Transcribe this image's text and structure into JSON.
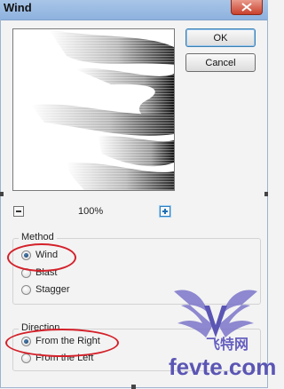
{
  "window": {
    "title": "Wind"
  },
  "buttons": {
    "ok_label": "OK",
    "cancel_label": "Cancel"
  },
  "preview": {
    "zoom_label": "100%"
  },
  "method": {
    "title": "Method",
    "options": [
      {
        "label": "Wind",
        "checked": true
      },
      {
        "label": "Blast",
        "checked": false
      },
      {
        "label": "Stagger",
        "checked": false
      }
    ]
  },
  "direction": {
    "title": "Direction",
    "options": [
      {
        "label": "From the Right",
        "checked": true
      },
      {
        "label": "From the Left",
        "checked": false
      }
    ]
  },
  "watermark": {
    "latin": "fevte.com",
    "cjk": "飞特网"
  },
  "colors": {
    "highlight": "#d4212a",
    "watermark": "#5b56b4",
    "titlebar": "#8db2de"
  }
}
